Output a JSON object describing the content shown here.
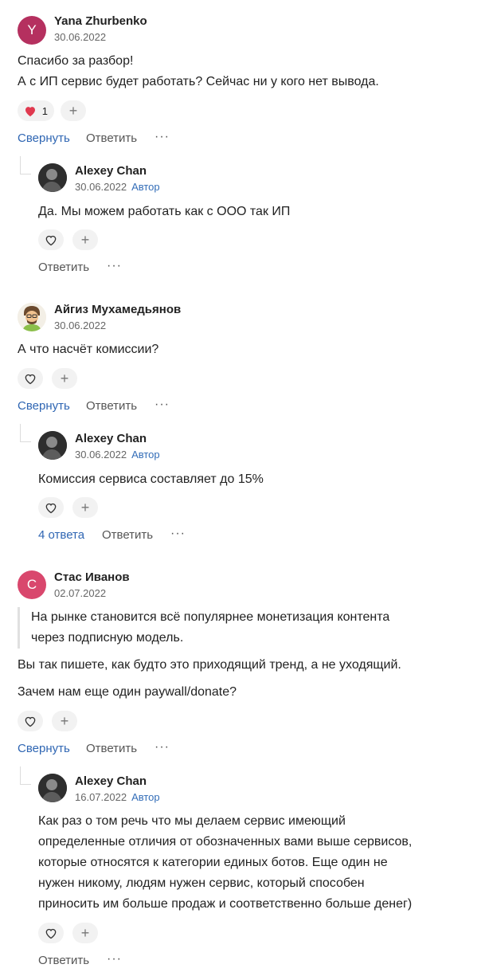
{
  "comments": [
    {
      "author": "Yana Zhurbenko",
      "avatar_letter": "Y",
      "avatar_color": "#b5305f",
      "date": "30.06.2022",
      "lines": [
        "Спасибо за разбор!",
        "А с ИП сервис будет работать? Сейчас ни у кого нет вывода."
      ],
      "likes": "1",
      "collapse_label": "Свернуть",
      "reply_label": "Ответить",
      "reply": {
        "author": "Alexey Chan",
        "date": "30.06.2022",
        "badge": "Автор",
        "text": "Да. Мы можем работать как с ООО так ИП",
        "reply_label": "Ответить"
      }
    },
    {
      "author": "Айгиз Мухамедьянов",
      "date": "30.06.2022",
      "text": "А что насчёт комиссии?",
      "collapse_label": "Свернуть",
      "reply_label": "Ответить",
      "reply": {
        "author": "Alexey Chan",
        "date": "30.06.2022",
        "badge": "Автор",
        "text": "Комиссия сервиса составляет до 15%",
        "answers_label": "4 ответа",
        "reply_label": "Ответить"
      }
    },
    {
      "author": "Стас Иванов",
      "avatar_letter": "С",
      "avatar_color": "#d9476d",
      "date": "02.07.2022",
      "quote_lines": [
        "На рынке становится всё популярнее монетизация контента",
        "через подписную модель."
      ],
      "text_1": "Вы так пишете, как будто это приходящий тренд, а не уходящий.",
      "text_2": "Зачем нам еще один paywall/donate?",
      "collapse_label": "Свернуть",
      "reply_label": "Ответить",
      "reply": {
        "author": "Alexey Chan",
        "date": "16.07.2022",
        "badge": "Автор",
        "lines": [
          "Как раз о том речь что мы делаем сервис имеющий",
          "определенные отличия от обозначенных вами выше сервисов,",
          "которые относятся к категории единых ботов. Еще один не",
          "нужен никому, людям нужен сервис, который способен",
          "приносить им больше продаж и соответственно больше денег)"
        ],
        "reply_label": "Ответить"
      }
    }
  ],
  "icons": {
    "heart": "heart-icon",
    "plus": "plus-icon",
    "more": "more-icon"
  },
  "colors": {
    "link": "#2f66b3",
    "badge": "#346eb8",
    "heart_filled": "#e0394f"
  }
}
